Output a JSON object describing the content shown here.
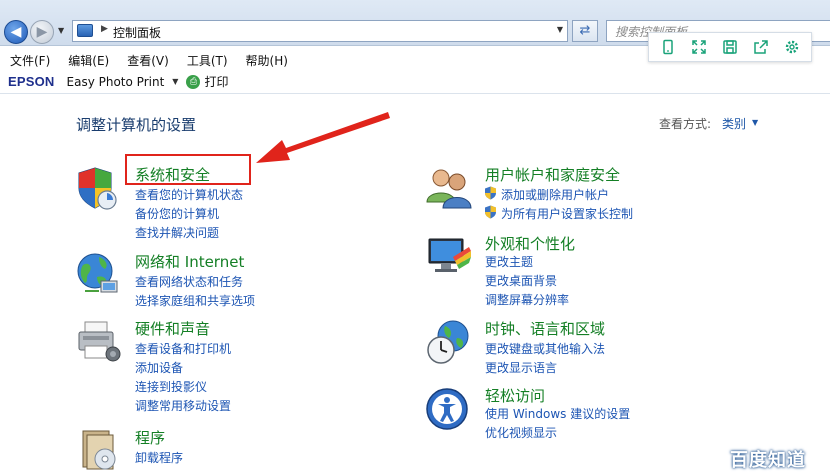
{
  "addressbar": {
    "breadcrumb": "控制面板",
    "search_placeholder": "搜索控制面板"
  },
  "menu": [
    "文件(F)",
    "编辑(E)",
    "查看(V)",
    "工具(T)",
    "帮助(H)"
  ],
  "epson": {
    "logo": "EPSON",
    "app": "Easy Photo Print",
    "print": "打印"
  },
  "main": {
    "title": "调整计算机的设置",
    "view_by_label": "查看方式:",
    "view_by_value": "类别"
  },
  "categories_left": [
    {
      "title": "系统和安全",
      "links": [
        "查看您的计算机状态",
        "备份您的计算机",
        "查找并解决问题"
      ],
      "icon": "shield-icon"
    },
    {
      "title": "网络和 Internet",
      "links": [
        "查看网络状态和任务",
        "选择家庭组和共享选项"
      ],
      "icon": "network-globe-icon"
    },
    {
      "title": "硬件和声音",
      "links": [
        "查看设备和打印机",
        "添加设备",
        "连接到投影仪",
        "调整常用移动设置"
      ],
      "icon": "printer-icon"
    },
    {
      "title": "程序",
      "links": [
        "卸载程序"
      ],
      "icon": "programs-icon"
    }
  ],
  "categories_right": [
    {
      "title": "用户帐户和家庭安全",
      "links": [
        "添加或删除用户帐户",
        "为所有用户设置家长控制"
      ],
      "icon": "users-icon"
    },
    {
      "title": "外观和个性化",
      "links": [
        "更改主题",
        "更改桌面背景",
        "调整屏幕分辨率"
      ],
      "icon": "monitor-paint-icon"
    },
    {
      "title": "时钟、语言和区域",
      "links": [
        "更改键盘或其他输入法",
        "更改显示语言"
      ],
      "icon": "clock-globe-icon"
    },
    {
      "title": "轻松访问",
      "links": [
        "使用 Windows 建议的设置",
        "优化视频显示"
      ],
      "icon": "ease-of-access-icon"
    }
  ],
  "watermark": "百度知道",
  "colors": {
    "category_title": "#147f25",
    "link": "#1d55b3",
    "highlight": "#e0241b"
  }
}
